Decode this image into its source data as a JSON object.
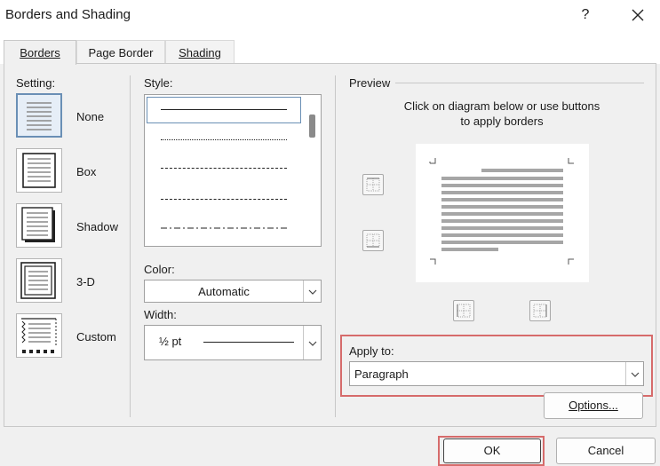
{
  "window": {
    "title": "Borders and Shading",
    "help_label": "?",
    "close_label": "✕"
  },
  "tabs": [
    {
      "label": "Borders",
      "active": true
    },
    {
      "label": "Page Border",
      "active": false
    },
    {
      "label": "Shading",
      "active": false
    }
  ],
  "setting": {
    "label": "Setting:",
    "items": [
      {
        "label": "None",
        "icon": "setting-none-icon",
        "selected": true
      },
      {
        "label": "Box",
        "icon": "setting-box-icon"
      },
      {
        "label": "Shadow",
        "icon": "setting-shadow-icon"
      },
      {
        "label": "3-D",
        "icon": "setting-3d-icon"
      },
      {
        "label": "Custom",
        "icon": "setting-custom-icon"
      }
    ]
  },
  "style": {
    "label": "Style:",
    "selected_index": 0
  },
  "color": {
    "label": "Color:",
    "value": "Automatic"
  },
  "width": {
    "label": "Width:",
    "value": "½ pt"
  },
  "preview": {
    "label": "Preview",
    "instruction_line1": "Click on diagram below or use buttons",
    "instruction_line2": "to apply borders"
  },
  "apply_to": {
    "label": "Apply to:",
    "value": "Paragraph"
  },
  "buttons": {
    "options": "Options...",
    "ok": "OK",
    "cancel": "Cancel"
  },
  "colors": {
    "highlight": "#d66b6b",
    "selected_setting": "#6a8fb5"
  }
}
